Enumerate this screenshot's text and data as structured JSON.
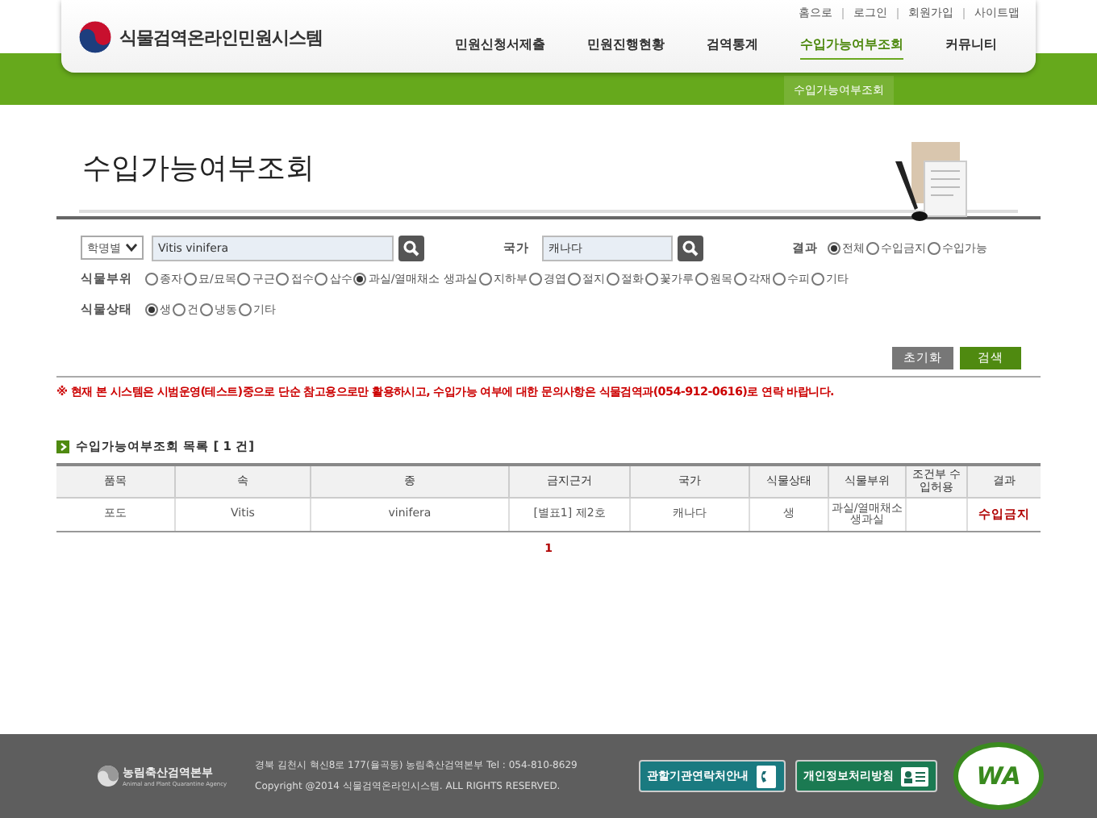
{
  "header": {
    "logo_text": "식물검역온라인민원시스템",
    "top_links": [
      "홈으로",
      "로그인",
      "회원가입",
      "사이트맵"
    ],
    "nav": [
      {
        "label": "민원신청서제출",
        "selected": false
      },
      {
        "label": "민원진행현황",
        "selected": false
      },
      {
        "label": "검역통계",
        "selected": false
      },
      {
        "label": "수입가능여부조회",
        "selected": true
      },
      {
        "label": "커뮤니티",
        "selected": false
      }
    ],
    "submenu": [
      {
        "label": "수입가능여부조회",
        "selected": true
      }
    ]
  },
  "page_title": "수입가능여부조회",
  "search": {
    "name_select": "학명별",
    "name_value": "Vitis vinifera",
    "country_label": "국가",
    "country_value": "캐나다",
    "result_label": "결과",
    "result_options": [
      {
        "label": "전체",
        "checked": true
      },
      {
        "label": "수입금지",
        "checked": false
      },
      {
        "label": "수입가능",
        "checked": false
      }
    ],
    "part_label": "식물부위",
    "part_options": [
      {
        "label": "종자",
        "checked": false
      },
      {
        "label": "묘/묘목",
        "checked": false
      },
      {
        "label": "구근",
        "checked": false
      },
      {
        "label": "접수",
        "checked": false
      },
      {
        "label": "삽수",
        "checked": false
      },
      {
        "label": "과실/열매채소 생과실",
        "checked": true
      },
      {
        "label": "지하부",
        "checked": false
      },
      {
        "label": "경엽",
        "checked": false
      },
      {
        "label": "절지",
        "checked": false
      },
      {
        "label": "절화",
        "checked": false
      },
      {
        "label": "꽃가루",
        "checked": false
      },
      {
        "label": "원목",
        "checked": false
      },
      {
        "label": "각재",
        "checked": false
      },
      {
        "label": "수피",
        "checked": false
      },
      {
        "label": "기타",
        "checked": false
      }
    ],
    "state_label": "식물상태",
    "state_options": [
      {
        "label": "생",
        "checked": true
      },
      {
        "label": "건",
        "checked": false
      },
      {
        "label": "냉동",
        "checked": false
      },
      {
        "label": "기타",
        "checked": false
      }
    ],
    "buttons": [
      {
        "label": "초기화",
        "kind": "reset"
      },
      {
        "label": "검색",
        "kind": "search"
      }
    ]
  },
  "notice": "※ 현재 본 시스템은 시범운영(테스트)중으로 단순 참고용으로만 활용하시고, 수입가능 여부에 대한 문의사항은 식물검역과(054-912-0616)로 연락 바랍니다.",
  "list": {
    "title": "수입가능여부조회 목록 [ 1 건]",
    "columns": [
      {
        "label": "품목",
        "kind": "text"
      },
      {
        "label": "속",
        "kind": "text"
      },
      {
        "label": "종",
        "kind": "text"
      },
      {
        "label": "금지근거",
        "kind": "text"
      },
      {
        "label": "국가",
        "kind": "text"
      },
      {
        "label": "식물상태",
        "kind": "text"
      },
      {
        "label": "식물부위",
        "kind": "text"
      },
      {
        "label": "조건부 수입허용",
        "kind": "text"
      },
      {
        "label": "결과",
        "kind": "result"
      }
    ],
    "rows": [
      [
        "포도",
        "Vitis",
        "vinifera",
        "[별표1] 제2호",
        "캐나다",
        "생",
        "과실/열매채소 생과실",
        "",
        "수입금지"
      ]
    ],
    "pagination": [
      {
        "label": "1",
        "selected": true
      }
    ]
  },
  "footer": {
    "agency": "농림축산검역본부",
    "agency_en": "Animal and Plant Quarantine Agency",
    "address": "경북 김천시 혁신8로 177(율곡동) 농림축산검역본부 Tel : 054-810-8629",
    "copyright": "Copyright @2014 식물검역온라인시스템. ALL RIGHTS RESERVED.",
    "buttons": [
      {
        "label": "관할기관연락처안내",
        "kind": "contact"
      },
      {
        "label": "개인정보처리방침",
        "kind": "privacy"
      }
    ],
    "badge": "WA"
  }
}
